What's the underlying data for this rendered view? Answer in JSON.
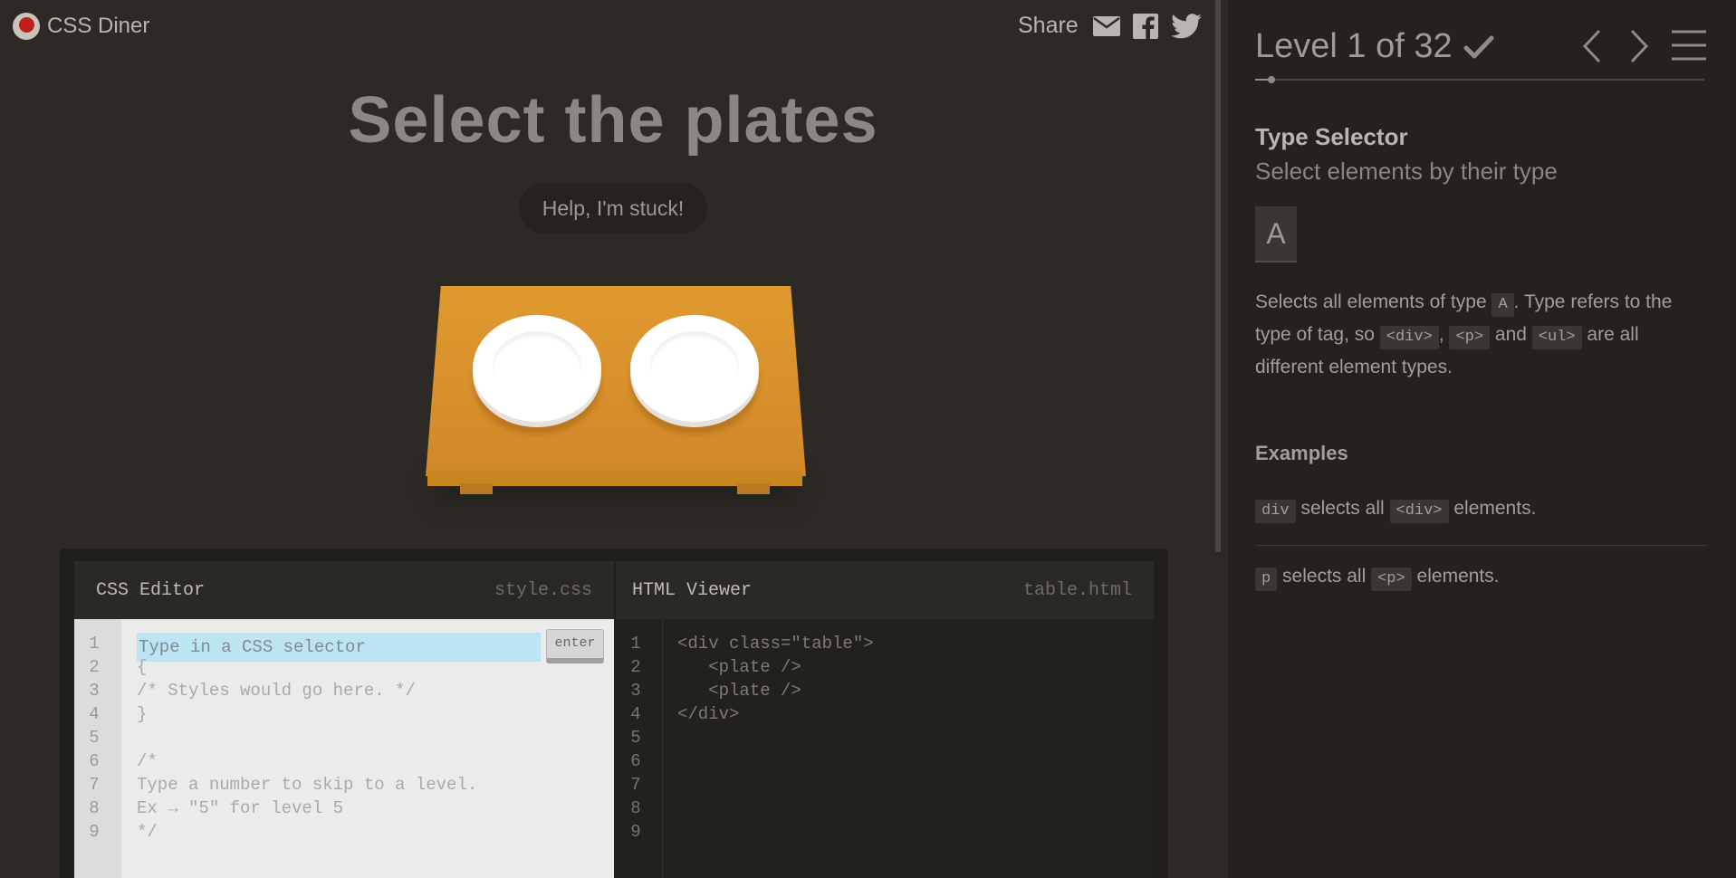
{
  "app": {
    "name": "CSS Diner"
  },
  "share": {
    "label": "Share"
  },
  "instruction": {
    "order": "Select the plates",
    "help_label": "Help, I'm stuck!"
  },
  "editor": {
    "css": {
      "title": "CSS Editor",
      "file": "style.css",
      "placeholder": "Type in a CSS selector",
      "enter_label": "enter",
      "line_numbers": [
        "1",
        "2",
        "3",
        "4",
        "5",
        "6",
        "7",
        "8",
        "9"
      ],
      "lines": [
        "",
        "{",
        "/* Styles would go here. */",
        "}",
        "",
        "/*",
        "Type a number to skip to a level.",
        "Ex → \"5\" for level 5",
        "*/"
      ]
    },
    "html": {
      "title": "HTML Viewer",
      "file": "table.html",
      "line_numbers": [
        "1",
        "2",
        "3",
        "4",
        "5",
        "6",
        "7",
        "8",
        "9"
      ],
      "lines": [
        "<div class=\"table\">",
        "   <plate />",
        "   <plate />",
        "</div>",
        "",
        "",
        "",
        "",
        ""
      ]
    }
  },
  "level": {
    "title": "Level 1 of 32",
    "current": 1,
    "total": 32,
    "selector_name": "Type Selector",
    "selector_title": "Select elements by their type",
    "syntax": "A",
    "hint": {
      "t1": "Selects all elements of type ",
      "tag_a": "A",
      "t2": ". Type refers to the type of tag, so ",
      "tag_div": "<div>",
      "t3": ", ",
      "tag_p": "<p>",
      "t4": " and ",
      "tag_ul": "<ul>",
      "t5": " are all different element types."
    },
    "examples_title": "Examples",
    "examples": [
      {
        "selector": "div",
        "text": "selects all",
        "element": "<div>",
        "suffix": "elements."
      },
      {
        "selector": "p",
        "text": "selects all",
        "element": "<p>",
        "suffix": "elements."
      }
    ]
  },
  "colors": {
    "background": "#2d2a26",
    "sidebar": "#24211e",
    "table": "#e09a2e",
    "input_highlight": "#bde4f3"
  },
  "icons": [
    "email-icon",
    "facebook-icon",
    "twitter-icon",
    "checkmark-icon",
    "chevron-left-icon",
    "chevron-right-icon",
    "menu-icon"
  ]
}
